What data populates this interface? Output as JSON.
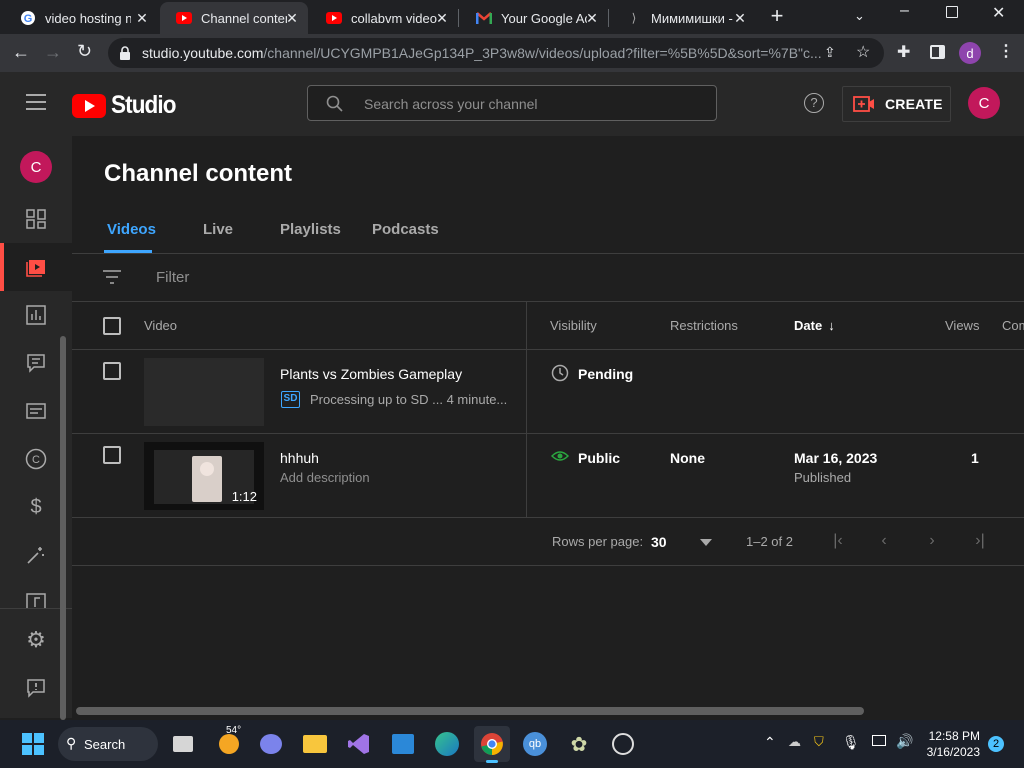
{
  "browser": {
    "tabs": [
      {
        "title": "video hosting no",
        "icon": "google-icon"
      },
      {
        "title": "Channel content",
        "icon": "youtube-icon",
        "active": true
      },
      {
        "title": "collabvm videos",
        "icon": "youtube-icon"
      },
      {
        "title": "Your Google Ac",
        "icon": "gmail-icon"
      },
      {
        "title": "Мимимишки -",
        "icon": "yandex-icon"
      }
    ],
    "url_host": "studio.youtube.com",
    "url_path": "/channel/UCYGMPB1AJeGp134P_3P3w8w/videos/upload?filter=%5B%5D&sort=%7B\"c...",
    "profile_initial": "d"
  },
  "header": {
    "logo_text": "Studio",
    "search_placeholder": "Search across your channel",
    "create_label": "CREATE",
    "avatar_initial": "C"
  },
  "sidebar": {
    "avatar_initial": "C",
    "items": [
      "dashboard-icon",
      "content-icon",
      "analytics-icon",
      "comments-icon",
      "subtitles-icon",
      "copyright-icon",
      "earn-icon",
      "customization-icon",
      "audio-library-icon",
      "settings-icon",
      "feedback-icon"
    ]
  },
  "main": {
    "title": "Channel content",
    "tabs": [
      "Videos",
      "Live",
      "Playlists",
      "Podcasts"
    ],
    "filter_label": "Filter",
    "columns": [
      "Video",
      "Visibility",
      "Restrictions",
      "Date",
      "Views",
      "Com"
    ],
    "rows": [
      {
        "title": "Plants vs Zombies Gameplay",
        "badge": "SD",
        "subtitle": "Processing up to SD ... 4 minute...",
        "visibility": "Pending",
        "restrictions": "",
        "date": "",
        "date_sub": "",
        "views": ""
      },
      {
        "title": "hhhuh",
        "subtitle": "Add description",
        "duration": "1:12",
        "visibility": "Public",
        "restrictions": "None",
        "date": "Mar 16, 2023",
        "date_sub": "Published",
        "views": "1"
      }
    ],
    "pagination": {
      "rows_label": "Rows per page:",
      "rows_value": "30",
      "range": "1–2 of 2"
    }
  },
  "taskbar": {
    "weather": "54°",
    "search_label": "Search",
    "time": "12:58 PM",
    "date": "3/16/2023",
    "notifications": "2"
  },
  "colors": {
    "accent_blue": "#3ea6ff",
    "youtube_red": "#ff0000",
    "avatar": "#c2185b"
  }
}
